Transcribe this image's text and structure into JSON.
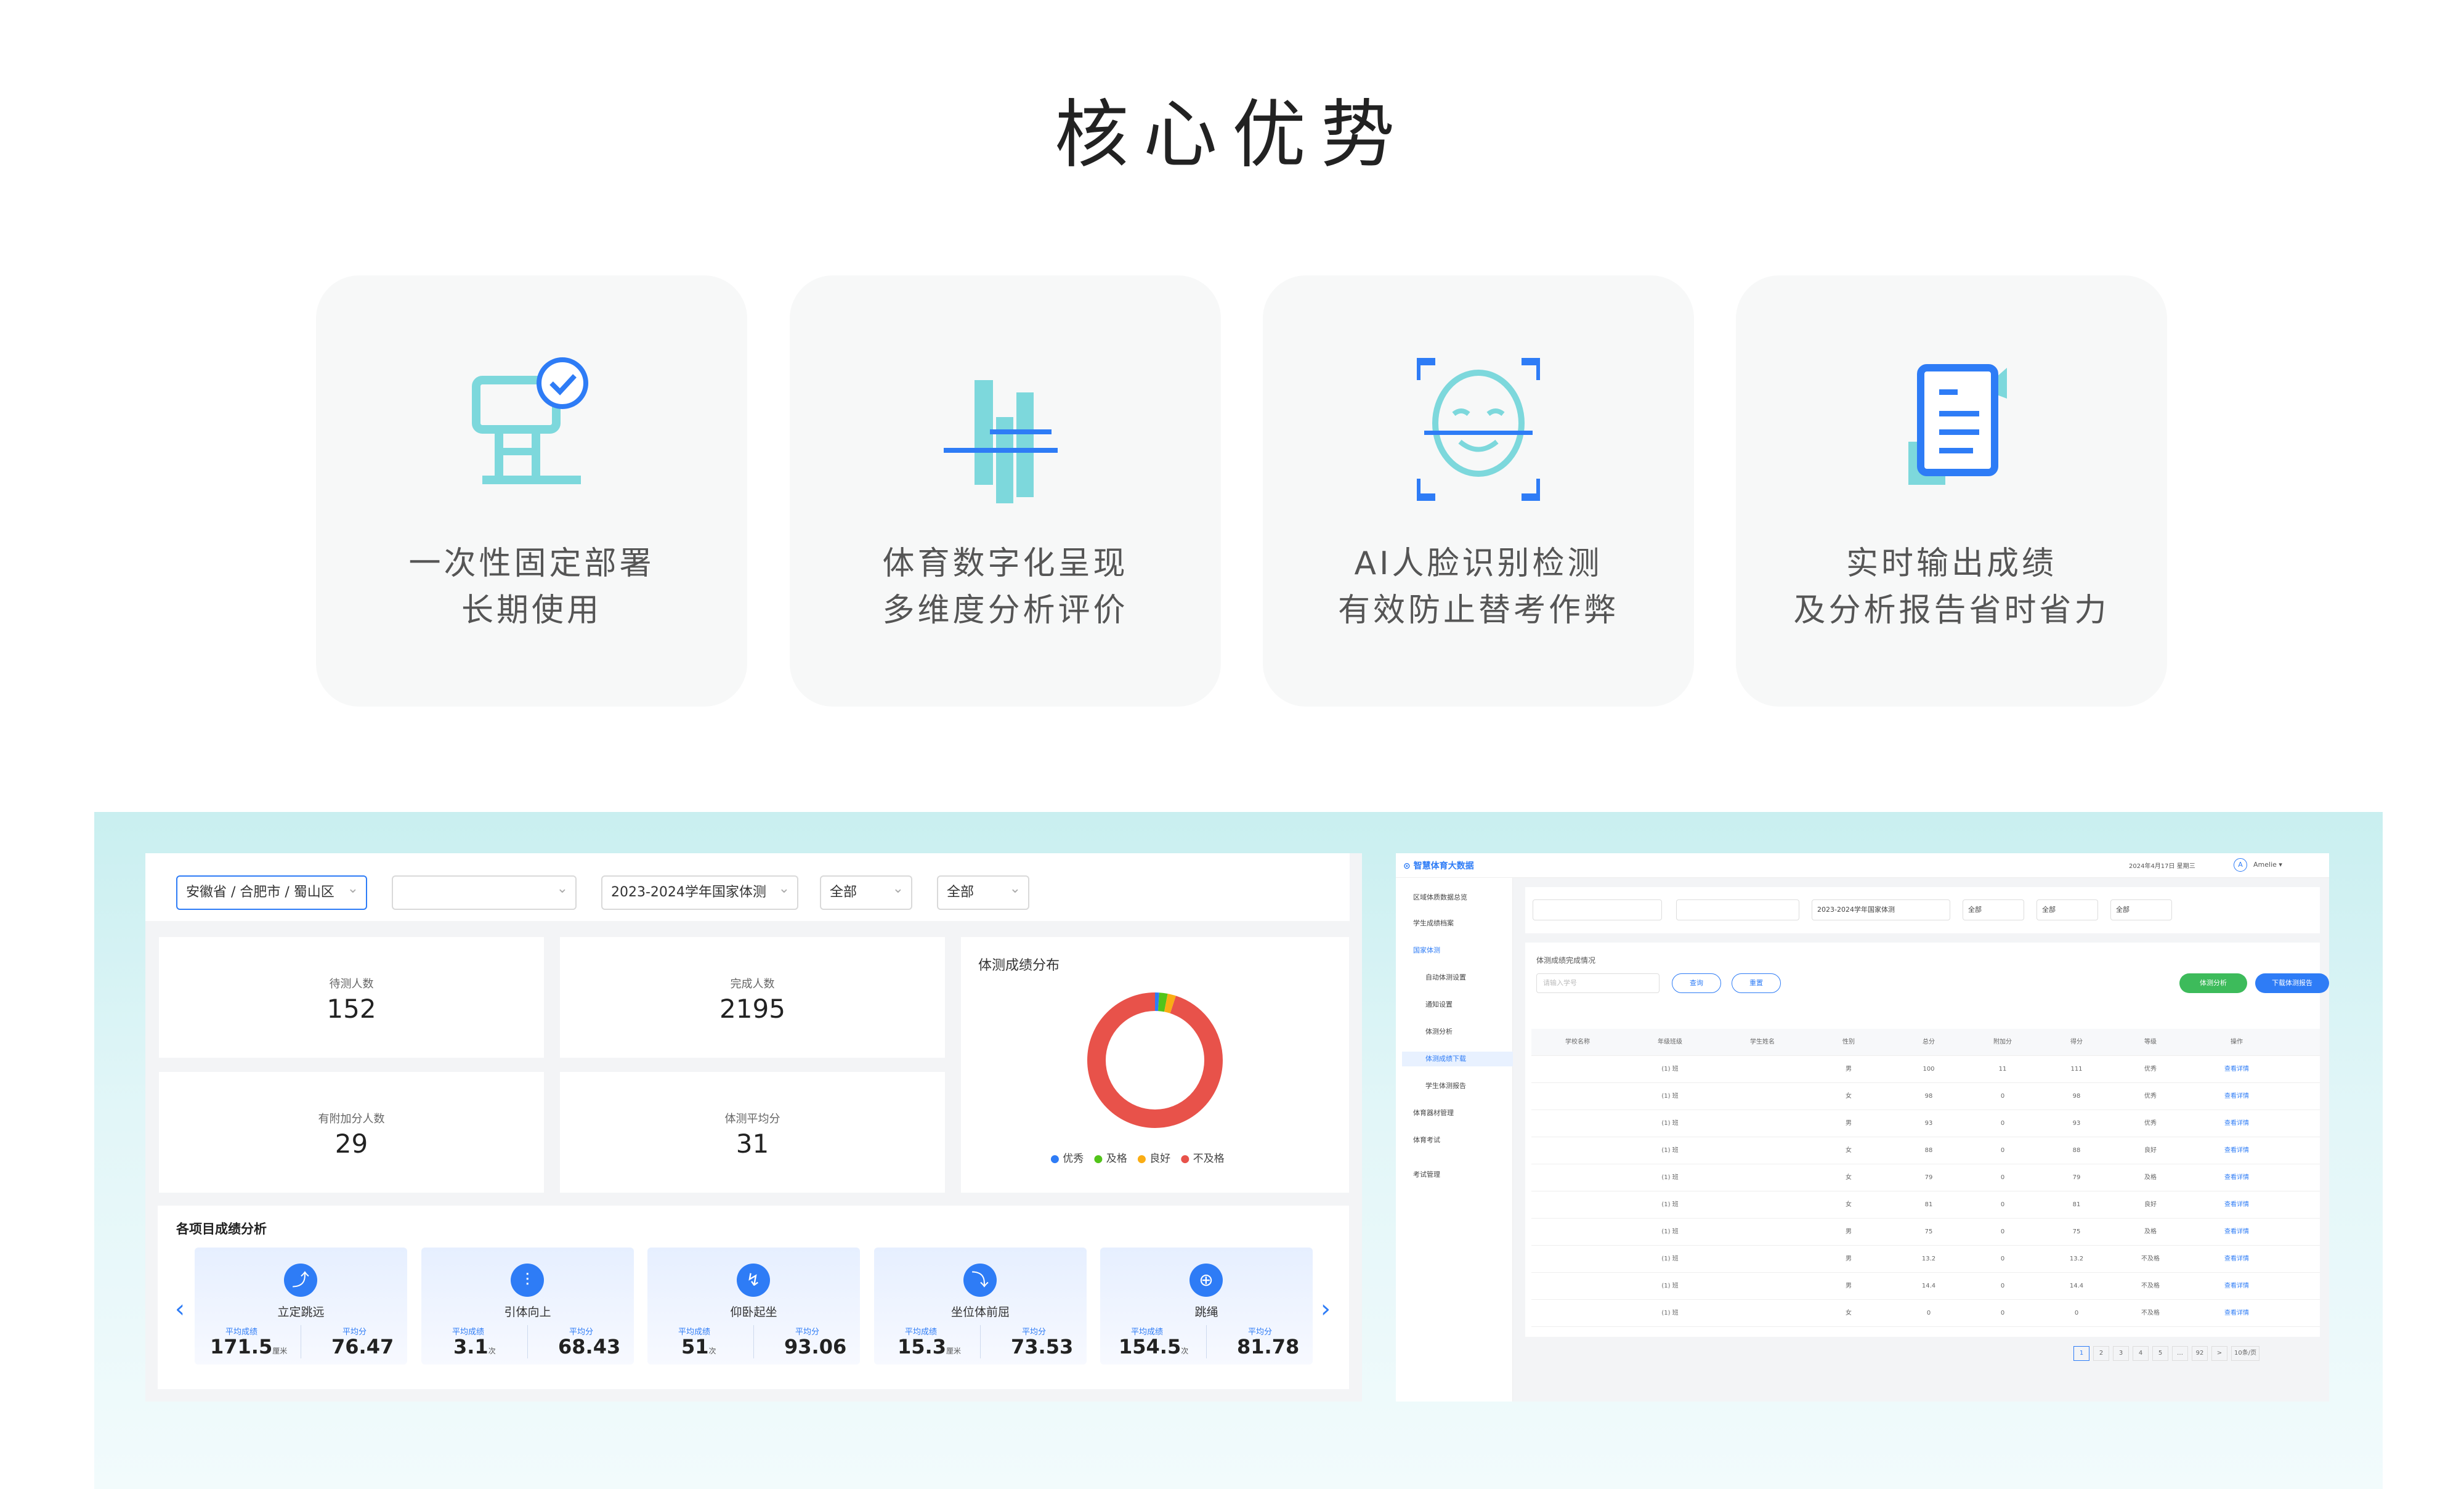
{
  "title": "核心优势",
  "cards": [
    {
      "icon": "kiosk-check-icon",
      "line1": "一次性固定部署",
      "line2": "长期使用"
    },
    {
      "icon": "bar-chart-icon",
      "line1": "体育数字化呈现",
      "line2": "多维度分析评价"
    },
    {
      "icon": "face-scan-icon",
      "line1": "AI人脸识别检测",
      "line2": "有效防止替考作弊"
    },
    {
      "icon": "report-document-icon",
      "line1": "实时输出成绩",
      "line2": "及分析报告省时省力"
    }
  ],
  "dashboard": {
    "filters": {
      "region": "安徽省 / 合肥市 / 蜀山区",
      "school": "",
      "exam": "2023-2024学年国家体测",
      "grade": "全部",
      "class": "全部"
    },
    "stats": [
      {
        "label": "待测人数",
        "value": "152"
      },
      {
        "label": "完成人数",
        "value": "2195"
      },
      {
        "label": "有附加分人数",
        "value": "29"
      },
      {
        "label": "体测平均分",
        "value": "31"
      }
    ],
    "distribution": {
      "title": "体测成绩分布",
      "legend": [
        "优秀",
        "及格",
        "良好",
        "不及格"
      ],
      "colors": [
        "#2e7cf6",
        "#52c41a",
        "#faad14",
        "#e8524a"
      ],
      "values": [
        1,
        2,
        2,
        95
      ]
    },
    "items_title": "各项目成绩分析",
    "items": [
      {
        "name": "立定跳远",
        "avg_label": "平均成绩",
        "avg": "171.5",
        "unit": "厘米",
        "score_label": "平均分",
        "score": "76.47"
      },
      {
        "name": "引体向上",
        "avg_label": "平均成绩",
        "avg": "3.1",
        "unit": "次",
        "score_label": "平均分",
        "score": "68.43"
      },
      {
        "name": "仰卧起坐",
        "avg_label": "平均成绩",
        "avg": "51",
        "unit": "次",
        "score_label": "平均分",
        "score": "93.06"
      },
      {
        "name": "坐位体前屈",
        "avg_label": "平均成绩",
        "avg": "15.3",
        "unit": "厘米",
        "score_label": "平均分",
        "score": "73.53"
      },
      {
        "name": "跳绳",
        "avg_label": "平均成绩",
        "avg": "154.5",
        "unit": "次",
        "score_label": "平均分",
        "score": "81.78"
      }
    ]
  },
  "table_app": {
    "app_name": "智慧体育大数据",
    "date": "2024年4月17日 星期三",
    "user": "Amelie",
    "sidebar": [
      "区域体质数据总览",
      "学生成绩档案",
      "国家体测",
      "自动体测设置",
      "通知设置",
      "体测分析",
      "体测成绩下载",
      "学生体测报告",
      "体育器材管理",
      "体育考试",
      "考试管理"
    ],
    "filters": [
      "",
      "",
      "2023-2024学年国家体测",
      "全部",
      "全部",
      "全部"
    ],
    "section_title": "体测成绩完成情况",
    "search_placeholder": "请输入学号",
    "btn_query": "查询",
    "btn_reset": "重置",
    "btn_analysis": "体测分析",
    "btn_download": "下载体测报告",
    "columns": [
      "学校名称",
      "年级班级",
      "学生姓名",
      "性别",
      "总分",
      "附加分",
      "得分",
      "等级",
      "操作"
    ],
    "rows": [
      [
        "",
        "(1) 班",
        "",
        "男",
        "100",
        "11",
        "111",
        "优秀",
        "查看详情"
      ],
      [
        "",
        "(1) 班",
        "",
        "女",
        "98",
        "0",
        "98",
        "优秀",
        "查看详情"
      ],
      [
        "",
        "(1) 班",
        "",
        "男",
        "93",
        "0",
        "93",
        "优秀",
        "查看详情"
      ],
      [
        "",
        "(1) 班",
        "",
        "女",
        "88",
        "0",
        "88",
        "良好",
        "查看详情"
      ],
      [
        "",
        "(1) 班",
        "",
        "女",
        "79",
        "0",
        "79",
        "及格",
        "查看详情"
      ],
      [
        "",
        "(1) 班",
        "",
        "女",
        "81",
        "0",
        "81",
        "良好",
        "查看详情"
      ],
      [
        "",
        "(1) 班",
        "",
        "男",
        "75",
        "0",
        "75",
        "及格",
        "查看详情"
      ],
      [
        "",
        "(1) 班",
        "",
        "男",
        "13.2",
        "0",
        "13.2",
        "不及格",
        "查看详情"
      ],
      [
        "",
        "(1) 班",
        "",
        "男",
        "14.4",
        "0",
        "14.4",
        "不及格",
        "查看详情"
      ],
      [
        "",
        "(1) 班",
        "",
        "女",
        "0",
        "0",
        "0",
        "不及格",
        "查看详情"
      ]
    ],
    "pagination": [
      "1",
      "2",
      "3",
      "4",
      "5",
      "…",
      "92",
      ">",
      "10条/页"
    ]
  }
}
